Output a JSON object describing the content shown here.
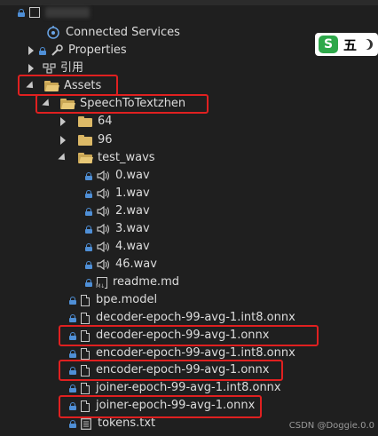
{
  "tree": {
    "project": "",
    "items": [
      {
        "label": "Connected Services"
      },
      {
        "label": "Properties"
      },
      {
        "label": "引用"
      },
      {
        "label": "Assets"
      },
      {
        "label": "SpeechToTextzhen"
      },
      {
        "label": "64"
      },
      {
        "label": "96"
      },
      {
        "label": "test_wavs"
      },
      {
        "label": "0.wav"
      },
      {
        "label": "1.wav"
      },
      {
        "label": "2.wav"
      },
      {
        "label": "3.wav"
      },
      {
        "label": "4.wav"
      },
      {
        "label": "46.wav"
      },
      {
        "label": "readme.md"
      },
      {
        "label": "bpe.model"
      },
      {
        "label": "decoder-epoch-99-avg-1.int8.onnx"
      },
      {
        "label": "decoder-epoch-99-avg-1.onnx"
      },
      {
        "label": "encoder-epoch-99-avg-1.int8.onnx"
      },
      {
        "label": "encoder-epoch-99-avg-1.onnx"
      },
      {
        "label": "joiner-epoch-99-avg-1.int8.onnx"
      },
      {
        "label": "joiner-epoch-99-avg-1.onnx"
      },
      {
        "label": "tokens.txt"
      }
    ]
  },
  "ime": {
    "logo": "S",
    "char": "五"
  },
  "watermark": "CSDN @Doggie.0.0",
  "colors": {
    "highlight_box": "#e02020",
    "lock": "#4f8fd6",
    "folder": "#dcb967",
    "background": "#1f1f1f"
  }
}
